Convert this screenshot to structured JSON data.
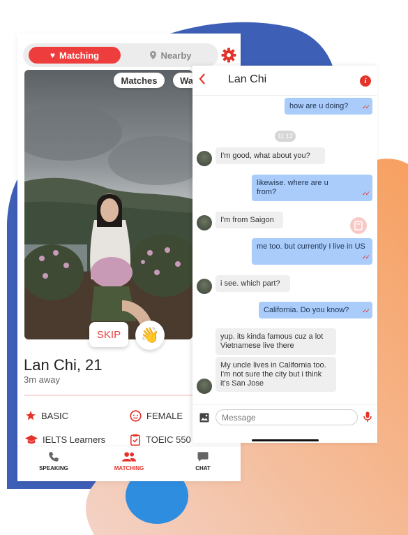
{
  "colors": {
    "accent": "#ee3d3d",
    "blue_blob": "#3d5fb6",
    "outgoing_bubble": "#a9ccfb",
    "incoming_bubble": "#efefef"
  },
  "segmented": {
    "matching_label": "Matching",
    "nearby_label": "Nearby",
    "matching_icon": "heart-icon",
    "nearby_icon": "location-pin-icon"
  },
  "settings_icon": "gear-icon",
  "photo_tabs": [
    "Matches",
    "Wa"
  ],
  "profile": {
    "name": "Lan Chi, 21",
    "distance": "3m away",
    "skip_label": "SKIP",
    "wave_emoji": "👋"
  },
  "attributes": [
    {
      "icon": "star-icon",
      "label": "BASIC"
    },
    {
      "icon": "face-icon",
      "label": "FEMALE"
    },
    {
      "icon": "graduation-cap-icon",
      "label": "IELTS Learners"
    },
    {
      "icon": "clipboard-icon",
      "label": "TOEIC 550"
    }
  ],
  "bottom_nav": [
    {
      "icon": "phone-icon",
      "label": "SPEAKING"
    },
    {
      "icon": "people-icon",
      "label": "MATCHING"
    },
    {
      "icon": "chat-bubble-icon",
      "label": "CHAT"
    }
  ],
  "chat": {
    "title": "Lan Chi",
    "time_divider": "11:12",
    "messages": [
      {
        "from": "me",
        "text": "how are u doing?",
        "read": true
      },
      {
        "from": "them",
        "text": "I'm good, what about you?"
      },
      {
        "from": "me",
        "text": "likewise. where are u from?",
        "read": true
      },
      {
        "from": "them",
        "text": "I'm from Saigon"
      },
      {
        "from": "me",
        "text": "me too. but currently I live in US",
        "read": true
      },
      {
        "from": "them",
        "text": "i see. which part?"
      },
      {
        "from": "me",
        "text": "California. Do you know?",
        "read": true
      },
      {
        "from": "them",
        "text": "yup. its kinda famous cuz a lot Vietnamese live there"
      },
      {
        "from": "them",
        "text": "My uncle lives in California too. I'm not sure the city but i think it's San Jose"
      }
    ],
    "input_placeholder": "Message",
    "read_tick": "✓✓"
  }
}
